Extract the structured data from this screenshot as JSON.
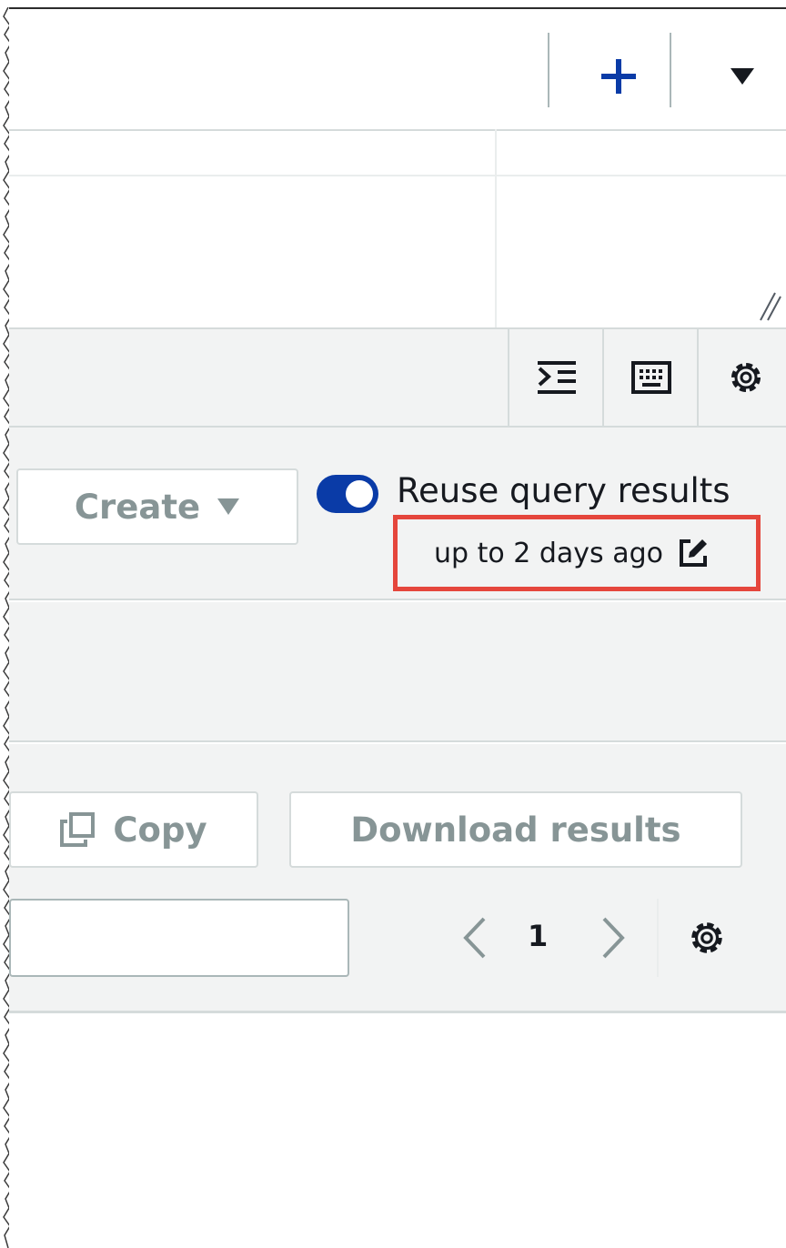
{
  "top_bar": {
    "icons": [
      "plus-icon",
      "caret-down-icon"
    ],
    "accent": "#0a3ba7"
  },
  "toolbar": {
    "icons": [
      "format-query-icon",
      "keyboard-icon",
      "settings-icon"
    ]
  },
  "actions": {
    "create_label": "Create",
    "reuse_toggle_on": true,
    "reuse_label": "Reuse query results",
    "reuse_age": "up to 2 days ago",
    "edit_icon": "edit-icon",
    "highlight_color": "#e5463c"
  },
  "results": {
    "copy_label": "Copy",
    "download_label": "Download results",
    "filter_value": "",
    "page_current": "1"
  }
}
